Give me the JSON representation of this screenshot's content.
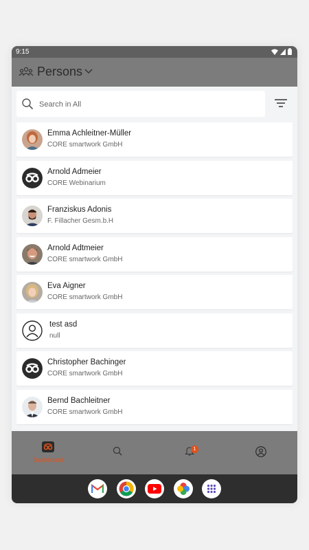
{
  "status": {
    "time": "9:15"
  },
  "header": {
    "title": "Persons"
  },
  "search": {
    "placeholder": "Search in All"
  },
  "persons": [
    {
      "name": "Emma Achleitner-Müller",
      "company": "CORE smartwork GmbH",
      "avatar": "photo-woman-red-hair"
    },
    {
      "name": "Arnold Admeier",
      "company": "CORE Webinarium",
      "avatar": "core-logo"
    },
    {
      "name": "Franziskus Adonis",
      "company": "F. Fillacher Gesm.b.H",
      "avatar": "photo-man-beard"
    },
    {
      "name": "Arnold Adtmeier",
      "company": "CORE smartwork GmbH",
      "avatar": "photo-man-smiling"
    },
    {
      "name": "Eva Aigner",
      "company": "CORE smartwork GmbH",
      "avatar": "photo-woman-blonde"
    },
    {
      "name": "test asd",
      "company": "null",
      "avatar": "default-person"
    },
    {
      "name": "Christopher Bachinger",
      "company": "CORE smartwork GmbH",
      "avatar": "core-logo"
    },
    {
      "name": "Bernd Bachleitner",
      "company": "CORE smartwork GmbH",
      "avatar": "photo-man-suit"
    }
  ],
  "bottom_nav": {
    "dashboard_label": "Dashboard",
    "notification_count": "1"
  },
  "dock": [
    "gmail-icon",
    "chrome-icon",
    "youtube-icon",
    "photos-icon",
    "app-drawer-icon"
  ],
  "colors": {
    "accent": "#e0521c",
    "appbar": "#7c7c7c",
    "statusbar": "#5f5f5f",
    "dock": "#2e2e2e"
  }
}
